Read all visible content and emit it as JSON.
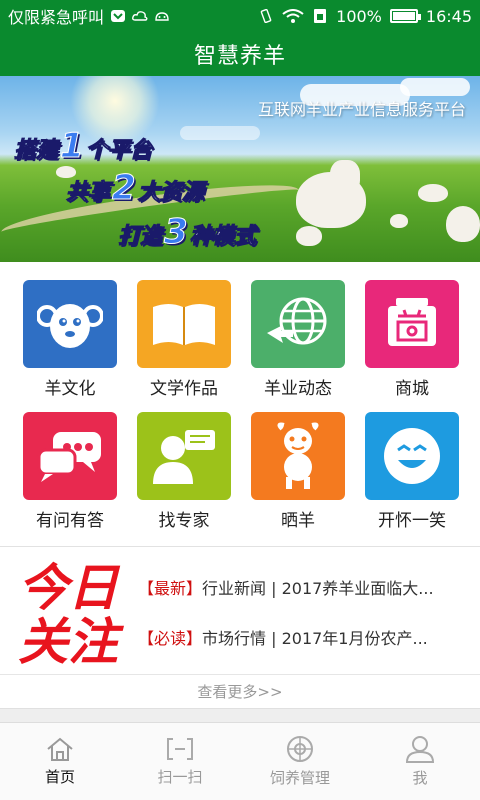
{
  "status_bar": {
    "carrier": "仅限紧急呼叫",
    "battery": "100%",
    "battery_level": 1.0,
    "time": "16:45"
  },
  "app": {
    "title": "智慧养羊"
  },
  "banner": {
    "subtitle": "互联网羊业产业信息服务平台",
    "slogans": [
      {
        "pre": "搭建",
        "num": "1",
        "post": "个平台"
      },
      {
        "pre": "共享",
        "num": "2",
        "post": "大资源"
      },
      {
        "pre": "打造",
        "num": "3",
        "post": "种模式"
      }
    ]
  },
  "grid": {
    "items": [
      {
        "label": "羊文化",
        "icon": "sheep-face-icon",
        "color": "#2f6fc4"
      },
      {
        "label": "文学作品",
        "icon": "open-book-icon",
        "color": "#f5a623"
      },
      {
        "label": "羊业动态",
        "icon": "globe-icon",
        "color": "#4caf6a"
      },
      {
        "label": "商城",
        "icon": "shop-icon",
        "color": "#e8287a"
      },
      {
        "label": "有问有答",
        "icon": "chat-bubbles-icon",
        "color": "#e8294f"
      },
      {
        "label": "找专家",
        "icon": "expert-icon",
        "color": "#9cc21a"
      },
      {
        "label": "晒羊",
        "icon": "goat-icon",
        "color": "#f47a1f"
      },
      {
        "label": "开怀一笑",
        "icon": "laugh-face-icon",
        "color": "#1e9be0"
      }
    ]
  },
  "today": {
    "logo_line1": "今日",
    "logo_line2": "关注",
    "news": [
      {
        "tag": "【最新】",
        "text": "行业新闻 | 2017养羊业面临大..."
      },
      {
        "tag": "【必读】",
        "text": "市场行情 | 2017年1月份农产..."
      }
    ],
    "more": "查看更多>>"
  },
  "bottom_nav": {
    "items": [
      {
        "label": "首页",
        "icon": "home-icon"
      },
      {
        "label": "扫一扫",
        "icon": "scan-icon"
      },
      {
        "label": "饲养管理",
        "icon": "target-icon"
      },
      {
        "label": "我",
        "icon": "user-icon"
      }
    ],
    "active": "首页"
  },
  "colors": {
    "primary_green": "#0a8a2e",
    "news_tag_red": "#d01010",
    "logo_red": "#e8141e"
  }
}
